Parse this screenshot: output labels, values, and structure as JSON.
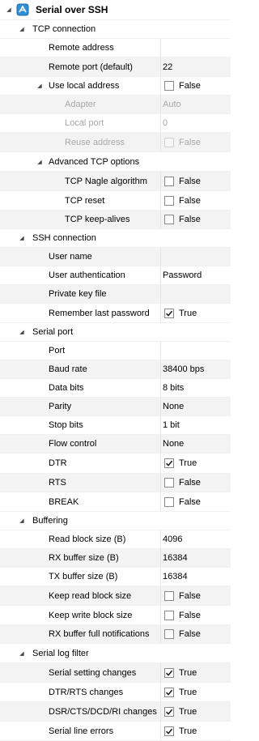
{
  "rows": [
    {
      "id": "serial-over-ssh",
      "label": "Serial over SSH",
      "kind": "root",
      "level": 0,
      "icon": "serial-ssh-icon"
    },
    {
      "id": "tcp-connection",
      "label": "TCP connection",
      "kind": "group",
      "level": 1
    },
    {
      "id": "remote-address",
      "label": "Remote address",
      "kind": "text",
      "level": 2,
      "value": ""
    },
    {
      "id": "remote-port",
      "label": "Remote port (default)",
      "kind": "text",
      "level": 2,
      "value": "22"
    },
    {
      "id": "use-local-address",
      "label": "Use local address",
      "kind": "bool",
      "level": 2,
      "expander": true,
      "checked": false,
      "value": "False"
    },
    {
      "id": "adapter",
      "label": "Adapter",
      "kind": "text",
      "level": 3,
      "disabled": true,
      "value": "Auto"
    },
    {
      "id": "local-port",
      "label": "Local port",
      "kind": "text",
      "level": 3,
      "disabled": true,
      "value": "0"
    },
    {
      "id": "reuse-address",
      "label": "Reuse address",
      "kind": "bool",
      "level": 3,
      "disabled": true,
      "checked": false,
      "value": "False"
    },
    {
      "id": "advanced-tcp-options",
      "label": "Advanced TCP options",
      "kind": "group",
      "level": 2
    },
    {
      "id": "tcp-nagle",
      "label": "TCP Nagle algorithm",
      "kind": "bool",
      "level": 3,
      "checked": false,
      "value": "False"
    },
    {
      "id": "tcp-reset",
      "label": "TCP reset",
      "kind": "bool",
      "level": 3,
      "checked": false,
      "value": "False"
    },
    {
      "id": "tcp-keep-alives",
      "label": "TCP keep-alives",
      "kind": "bool",
      "level": 3,
      "checked": false,
      "value": "False"
    },
    {
      "id": "ssh-connection",
      "label": "SSH connection",
      "kind": "group",
      "level": 1
    },
    {
      "id": "user-name",
      "label": "User name",
      "kind": "text",
      "level": 2,
      "value": ""
    },
    {
      "id": "user-authentication",
      "label": "User authentication",
      "kind": "text",
      "level": 2,
      "value": "Password"
    },
    {
      "id": "private-key-file",
      "label": "Private key file",
      "kind": "text",
      "level": 2,
      "value": ""
    },
    {
      "id": "remember-last-password",
      "label": "Remember last password",
      "kind": "bool",
      "level": 2,
      "checked": true,
      "value": "True"
    },
    {
      "id": "serial-port",
      "label": "Serial port",
      "kind": "group",
      "level": 1
    },
    {
      "id": "port",
      "label": "Port",
      "kind": "text",
      "level": 2,
      "value": ""
    },
    {
      "id": "baud-rate",
      "label": "Baud rate",
      "kind": "text",
      "level": 2,
      "value": "38400 bps"
    },
    {
      "id": "data-bits",
      "label": "Data bits",
      "kind": "text",
      "level": 2,
      "value": "8 bits"
    },
    {
      "id": "parity",
      "label": "Parity",
      "kind": "text",
      "level": 2,
      "value": "None"
    },
    {
      "id": "stop-bits",
      "label": "Stop bits",
      "kind": "text",
      "level": 2,
      "value": "1 bit"
    },
    {
      "id": "flow-control",
      "label": "Flow control",
      "kind": "text",
      "level": 2,
      "value": "None"
    },
    {
      "id": "dtr",
      "label": "DTR",
      "kind": "bool",
      "level": 2,
      "checked": true,
      "value": "True"
    },
    {
      "id": "rts",
      "label": "RTS",
      "kind": "bool",
      "level": 2,
      "checked": false,
      "value": "False"
    },
    {
      "id": "break",
      "label": "BREAK",
      "kind": "bool",
      "level": 2,
      "checked": false,
      "value": "False"
    },
    {
      "id": "buffering",
      "label": "Buffering",
      "kind": "group",
      "level": 1
    },
    {
      "id": "read-block-size",
      "label": "Read block size (B)",
      "kind": "text",
      "level": 2,
      "value": "4096"
    },
    {
      "id": "rx-buffer-size",
      "label": "RX buffer size (B)",
      "kind": "text",
      "level": 2,
      "value": "16384"
    },
    {
      "id": "tx-buffer-size",
      "label": "TX buffer size (B)",
      "kind": "text",
      "level": 2,
      "value": "16384"
    },
    {
      "id": "keep-read-block-size",
      "label": "Keep read block size",
      "kind": "bool",
      "level": 2,
      "checked": false,
      "value": "False"
    },
    {
      "id": "keep-write-block-size",
      "label": "Keep write block size",
      "kind": "bool",
      "level": 2,
      "checked": false,
      "value": "False"
    },
    {
      "id": "rx-buffer-full-notifications",
      "label": "RX buffer full notifications",
      "kind": "bool",
      "level": 2,
      "checked": false,
      "value": "False"
    },
    {
      "id": "serial-log-filter",
      "label": "Serial log filter",
      "kind": "group",
      "level": 1
    },
    {
      "id": "serial-setting-changes",
      "label": "Serial setting changes",
      "kind": "bool",
      "level": 2,
      "checked": true,
      "value": "True"
    },
    {
      "id": "dtr-rts-changes",
      "label": "DTR/RTS changes",
      "kind": "bool",
      "level": 2,
      "checked": true,
      "value": "True"
    },
    {
      "id": "dsr-cts-dcd-ri-changes",
      "label": "DSR/CTS/DCD/RI changes",
      "kind": "bool",
      "level": 2,
      "checked": true,
      "value": "True"
    },
    {
      "id": "serial-line-errors",
      "label": "Serial line errors",
      "kind": "bool",
      "level": 2,
      "checked": true,
      "value": "True"
    }
  ]
}
